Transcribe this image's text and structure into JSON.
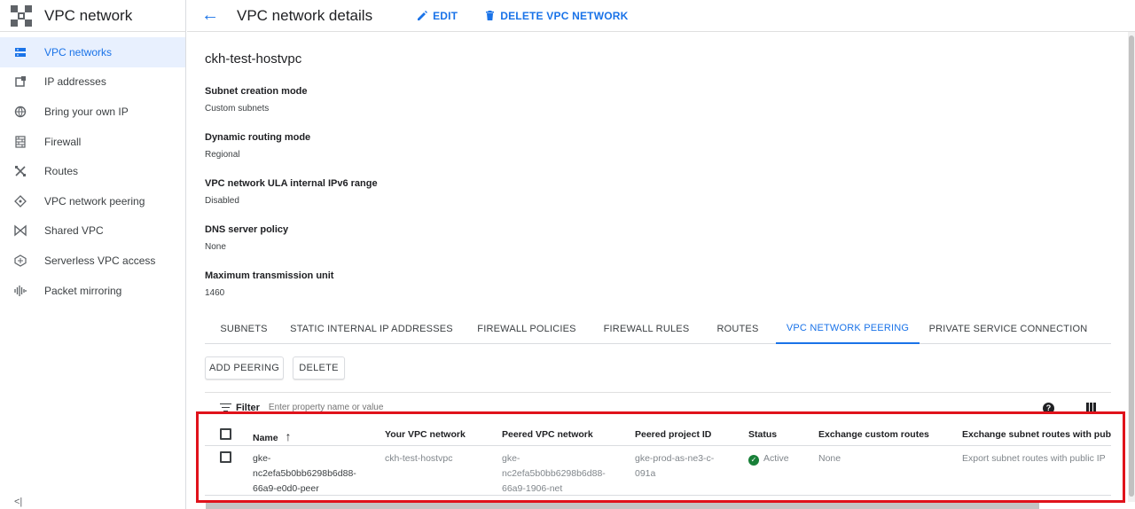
{
  "sidebar": {
    "title": "VPC network",
    "items": [
      {
        "label": "VPC networks",
        "icon": "vpc-networks-icon",
        "active": true
      },
      {
        "label": "IP addresses",
        "icon": "ip-addresses-icon"
      },
      {
        "label": "Bring your own IP",
        "icon": "globe-icon"
      },
      {
        "label": "Firewall",
        "icon": "firewall-icon"
      },
      {
        "label": "Routes",
        "icon": "routes-icon"
      },
      {
        "label": "VPC network peering",
        "icon": "peering-icon"
      },
      {
        "label": "Shared VPC",
        "icon": "shared-vpc-icon"
      },
      {
        "label": "Serverless VPC access",
        "icon": "serverless-icon"
      },
      {
        "label": "Packet mirroring",
        "icon": "packet-mirroring-icon"
      }
    ],
    "collapse_label": "<|"
  },
  "header": {
    "title": "VPC network details",
    "edit_label": "EDIT",
    "delete_label": "DELETE VPC NETWORK"
  },
  "details": {
    "name": "ckh-test-hostvpc",
    "properties": [
      {
        "label": "Subnet creation mode",
        "value": "Custom subnets"
      },
      {
        "label": "Dynamic routing mode",
        "value": "Regional"
      },
      {
        "label": "VPC network ULA internal IPv6 range",
        "value": "Disabled"
      },
      {
        "label": "DNS server policy",
        "value": "None"
      },
      {
        "label": "Maximum transmission unit",
        "value": "1460"
      }
    ]
  },
  "tabs": [
    {
      "label": "SUBNETS"
    },
    {
      "label": "STATIC INTERNAL IP ADDRESSES"
    },
    {
      "label": "FIREWALL POLICIES"
    },
    {
      "label": "FIREWALL RULES"
    },
    {
      "label": "ROUTES"
    },
    {
      "label": "VPC NETWORK PEERING",
      "active": true
    },
    {
      "label": "PRIVATE SERVICE CONNECTION"
    }
  ],
  "actions": {
    "add_peering": "ADD PEERING",
    "delete": "DELETE"
  },
  "filter": {
    "label": "Filter",
    "placeholder": "Enter property name or value",
    "help": "?"
  },
  "table": {
    "columns": [
      "Name",
      "Your VPC network",
      "Peered VPC network",
      "Peered project ID",
      "Status",
      "Exchange custom routes",
      "Exchange subnet routes with public IP"
    ],
    "sort_indicator": "↑",
    "rows": [
      {
        "name": "gke-nc2efa5b0bb6298b6d88-66a9-e0d0-peer",
        "name_lines": [
          "gke-",
          "nc2efa5b0bb6298b6d88-",
          "66a9-e0d0-peer"
        ],
        "your_network": "ckh-test-hostvpc",
        "peered_network_lines": [
          "gke-",
          "nc2efa5b0bb6298b6d88-",
          "66a9-1906-net"
        ],
        "peered_project_lines": [
          "gke-prod-as-ne3-c-",
          "091a"
        ],
        "status": "Active",
        "exchange_custom_routes": "None",
        "exchange_subnet_routes": "Export subnet routes with public IP"
      }
    ]
  },
  "colors": {
    "accent": "#1a73e8",
    "active_bg": "#e8f0fe",
    "highlight": "#e0121b",
    "status_ok": "#188038"
  }
}
